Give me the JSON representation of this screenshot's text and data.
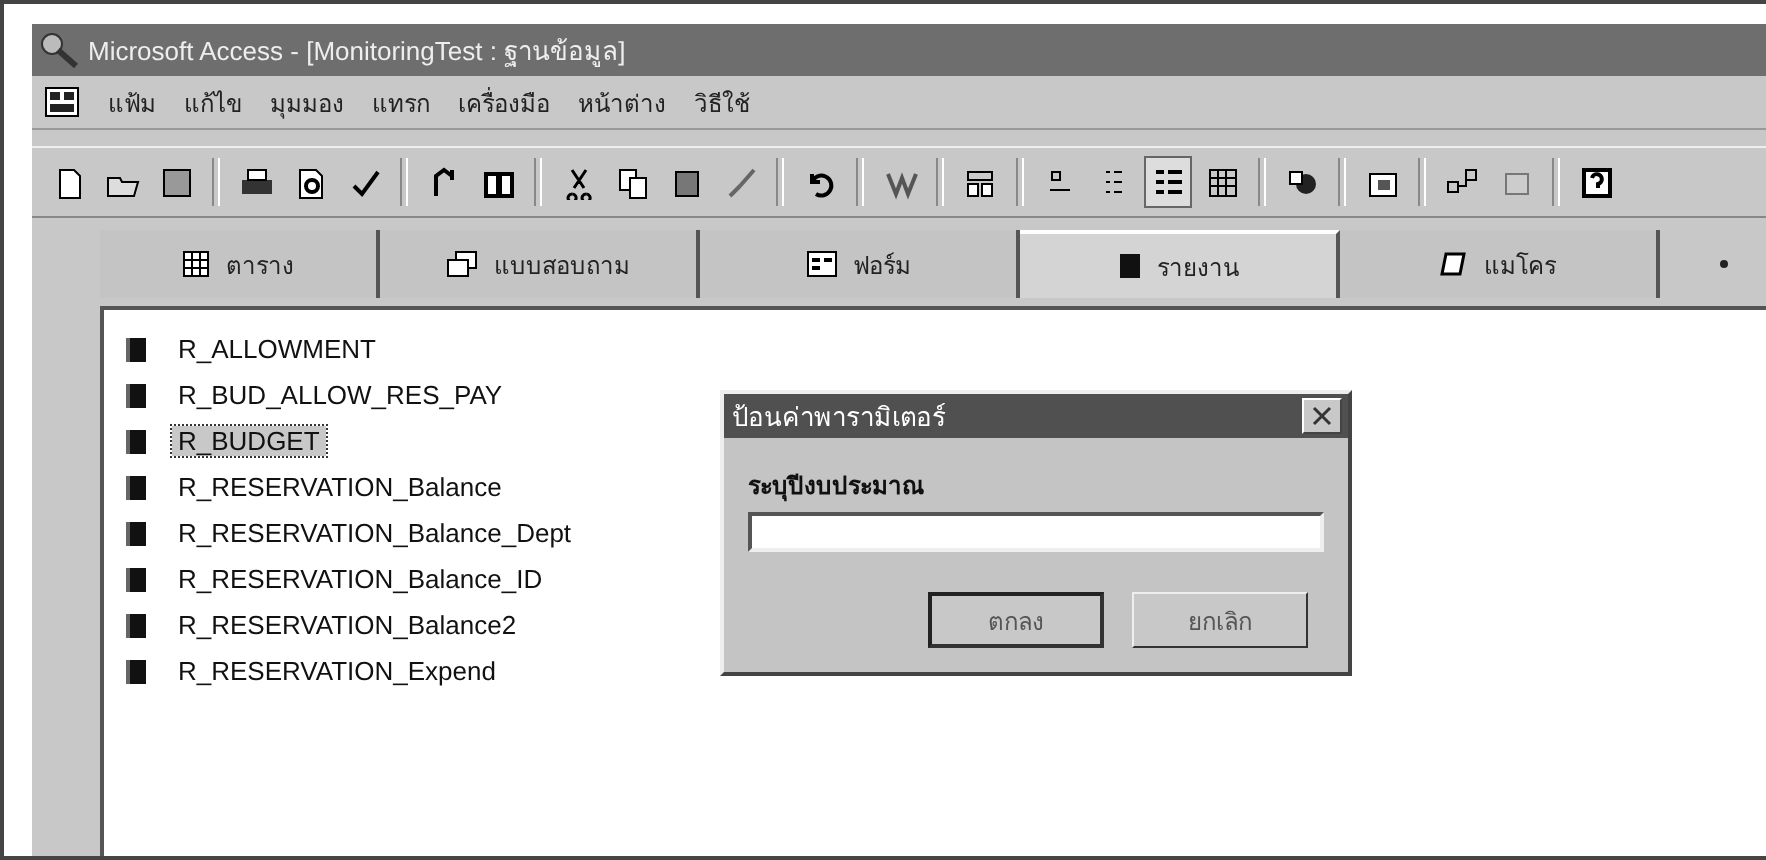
{
  "window": {
    "title": "Microsoft Access - [MonitoringTest : ฐานข้อมูล]"
  },
  "menu": [
    "แฟ้ม",
    "แก้ไข",
    "มุมมอง",
    "แทรก",
    "เครื่องมือ",
    "หน้าต่าง",
    "วิธีใช้"
  ],
  "tabs": [
    {
      "label": "ตาราง",
      "kind": "table",
      "selected": false
    },
    {
      "label": "แบบสอบถาม",
      "kind": "query",
      "selected": false
    },
    {
      "label": "ฟอร์ม",
      "kind": "form",
      "selected": false
    },
    {
      "label": "รายงาน",
      "kind": "report",
      "selected": true
    },
    {
      "label": "แมโคร",
      "kind": "macro",
      "selected": false
    }
  ],
  "reports": [
    {
      "name": "R_ALLOWMENT",
      "selected": false
    },
    {
      "name": "R_BUD_ALLOW_RES_PAY",
      "selected": false
    },
    {
      "name": "R_BUDGET",
      "selected": true
    },
    {
      "name": "R_RESERVATION_Balance",
      "selected": false
    },
    {
      "name": "R_RESERVATION_Balance_Dept",
      "selected": false
    },
    {
      "name": "R_RESERVATION_Balance_ID",
      "selected": false
    },
    {
      "name": "R_RESERVATION_Balance2",
      "selected": false
    },
    {
      "name": "R_RESERVATION_Expend",
      "selected": false
    }
  ],
  "dialog": {
    "title": "ป้อนค่าพารามิเตอร์",
    "prompt": "ระบุปีงบประมาณ",
    "buttons": [
      {
        "label": "ตกลง",
        "default": true
      },
      {
        "label": "ยกเลิก",
        "default": false
      }
    ]
  }
}
